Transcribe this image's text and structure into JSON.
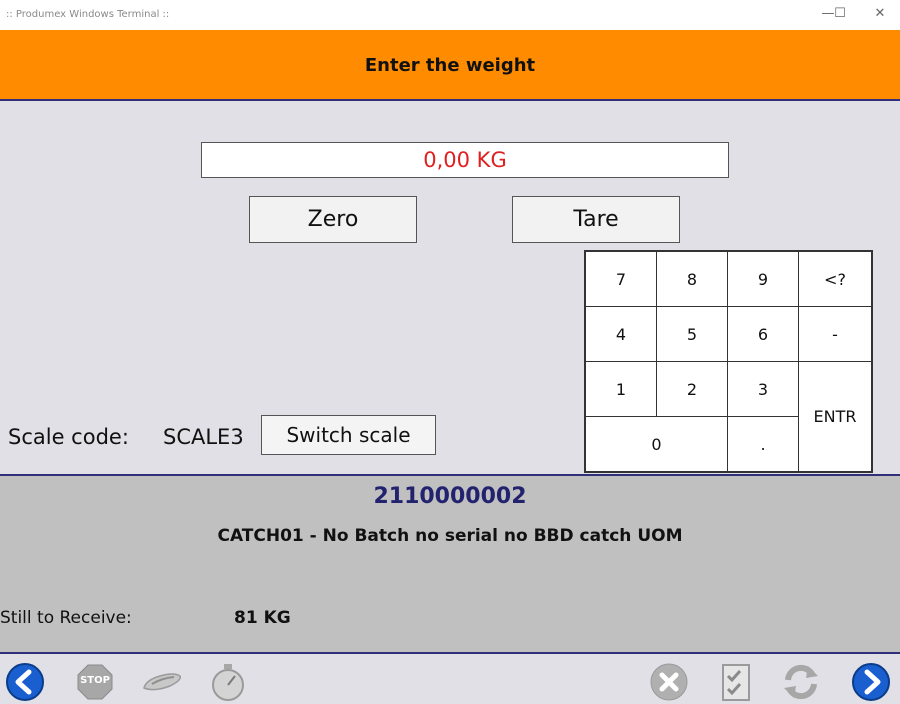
{
  "window": {
    "title": ":: Produmex Windows Terminal ::",
    "minimize": "—",
    "maximize": "☐",
    "close": "✕"
  },
  "header": {
    "title": "Enter the weight"
  },
  "weight": {
    "value": "0,00 KG"
  },
  "buttons": {
    "zero": "Zero",
    "tare": "Tare",
    "switch_scale": "Switch scale"
  },
  "keypad": {
    "k7": "7",
    "k8": "8",
    "k9": "9",
    "backspace": "<?",
    "k4": "4",
    "k5": "5",
    "k6": "6",
    "minus": "-",
    "k1": "1",
    "k2": "2",
    "k3": "3",
    "enter": "ENTR",
    "k0": "0",
    "dot": "."
  },
  "scale": {
    "label": "Scale code:",
    "value": "SCALE3"
  },
  "item": {
    "code": "2110000002",
    "description": "CATCH01 - No Batch no serial no BBD catch UOM",
    "still_label": "Still to Receive:",
    "still_value": "81 KG"
  },
  "footer": {
    "icons": [
      "back-arrow-icon",
      "stop-icon",
      "scanner-icon",
      "stopwatch-icon",
      "cancel-icon",
      "checklist-icon",
      "refresh-icon",
      "forward-arrow-icon"
    ],
    "stop_text": "STOP"
  },
  "colors": {
    "header": "#ff8c00",
    "accent": "#2f2f7a",
    "weight_text": "#e02020",
    "nav_blue": "#1a5fd0"
  }
}
